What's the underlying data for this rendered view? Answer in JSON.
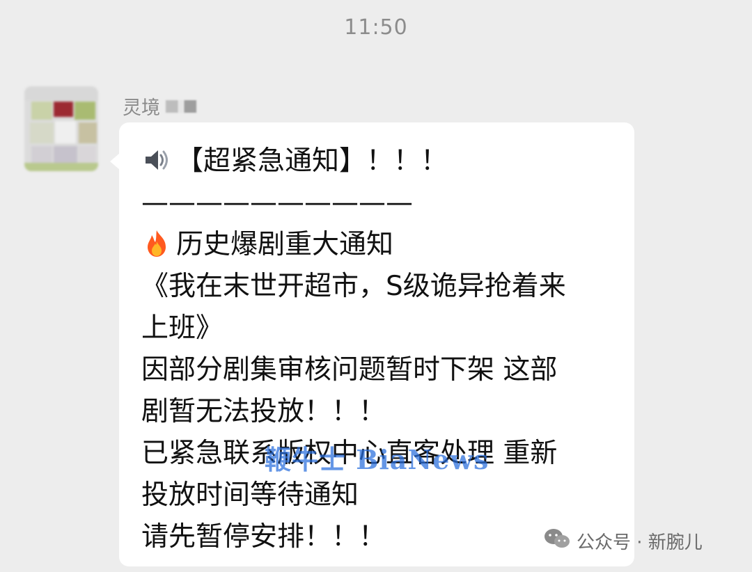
{
  "chat": {
    "timestamp": "11:50",
    "sender_name": "灵境"
  },
  "message": {
    "lines": [
      "【超紧急通知】！！！",
      "——————————",
      "历史爆剧重大通知",
      "《我在末世开超市，S级诡异抢着来",
      "上班》",
      "因部分剧集审核问题暂时下架 这部",
      "剧暂无法投放！！！",
      "已紧急联系版权中心直客处理 重新",
      "投放时间等待通知",
      "请先暂停安排！！！"
    ],
    "icons": [
      "speaker-icon",
      "fire-icon"
    ]
  },
  "overlay": {
    "watermark": "鞭牛士 BiaNews",
    "source": "公众号 · 新腕儿",
    "source_icon": "wechat-icon"
  },
  "colors": {
    "background": "#ededed",
    "bubble": "#ffffff",
    "watermark": "#2a6edc"
  }
}
